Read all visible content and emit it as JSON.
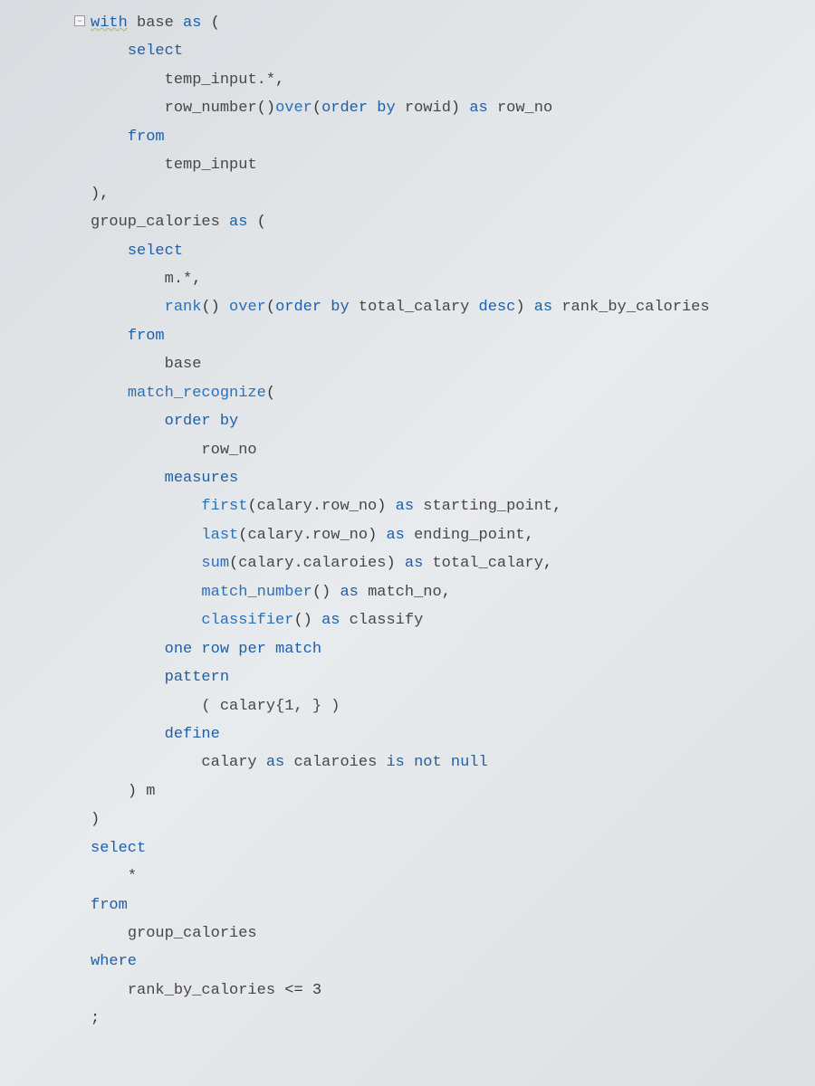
{
  "fold_marker": "−",
  "tokens": {
    "with": "with",
    "as": "as",
    "select": "select",
    "from": "from",
    "over": "over",
    "order_by": "order by",
    "desc": "desc",
    "measures": "measures",
    "one_row_per_match": "one row per match",
    "pattern": "pattern",
    "define": "define",
    "is_not_null": "is not null",
    "where": "where"
  },
  "fn": {
    "row_number": "row_number",
    "rank": "rank",
    "first": "first",
    "last": "last",
    "sum": "sum",
    "match_number": "match_number",
    "classifier": "classifier",
    "match_recognize": "match_recognize"
  },
  "id": {
    "base": "base",
    "temp_input": "temp_input",
    "temp_input_star": "temp_input.*",
    "rowid": "rowid",
    "row_no": "row_no",
    "group_calories": "group_calories",
    "m_star": "m.*",
    "total_calary": "total_calary",
    "rank_by_calories": "rank_by_calories",
    "calary_row_no": "calary.row_no",
    "starting_point": "starting_point",
    "ending_point": "ending_point",
    "calary_calaroies": "calary.calaroies",
    "match_no": "match_no",
    "classify": "classify",
    "calary": "calary",
    "calaroies": "calaroies",
    "m": "m",
    "star": "*"
  },
  "lit": {
    "pattern_body": "( calary{1, } )",
    "three": "3",
    "lte": "<=",
    "semi": ";",
    "deco": {
      "open_paren": "(",
      "close_paren": ")",
      "empty_parens": "()",
      "comma": ","
    }
  }
}
